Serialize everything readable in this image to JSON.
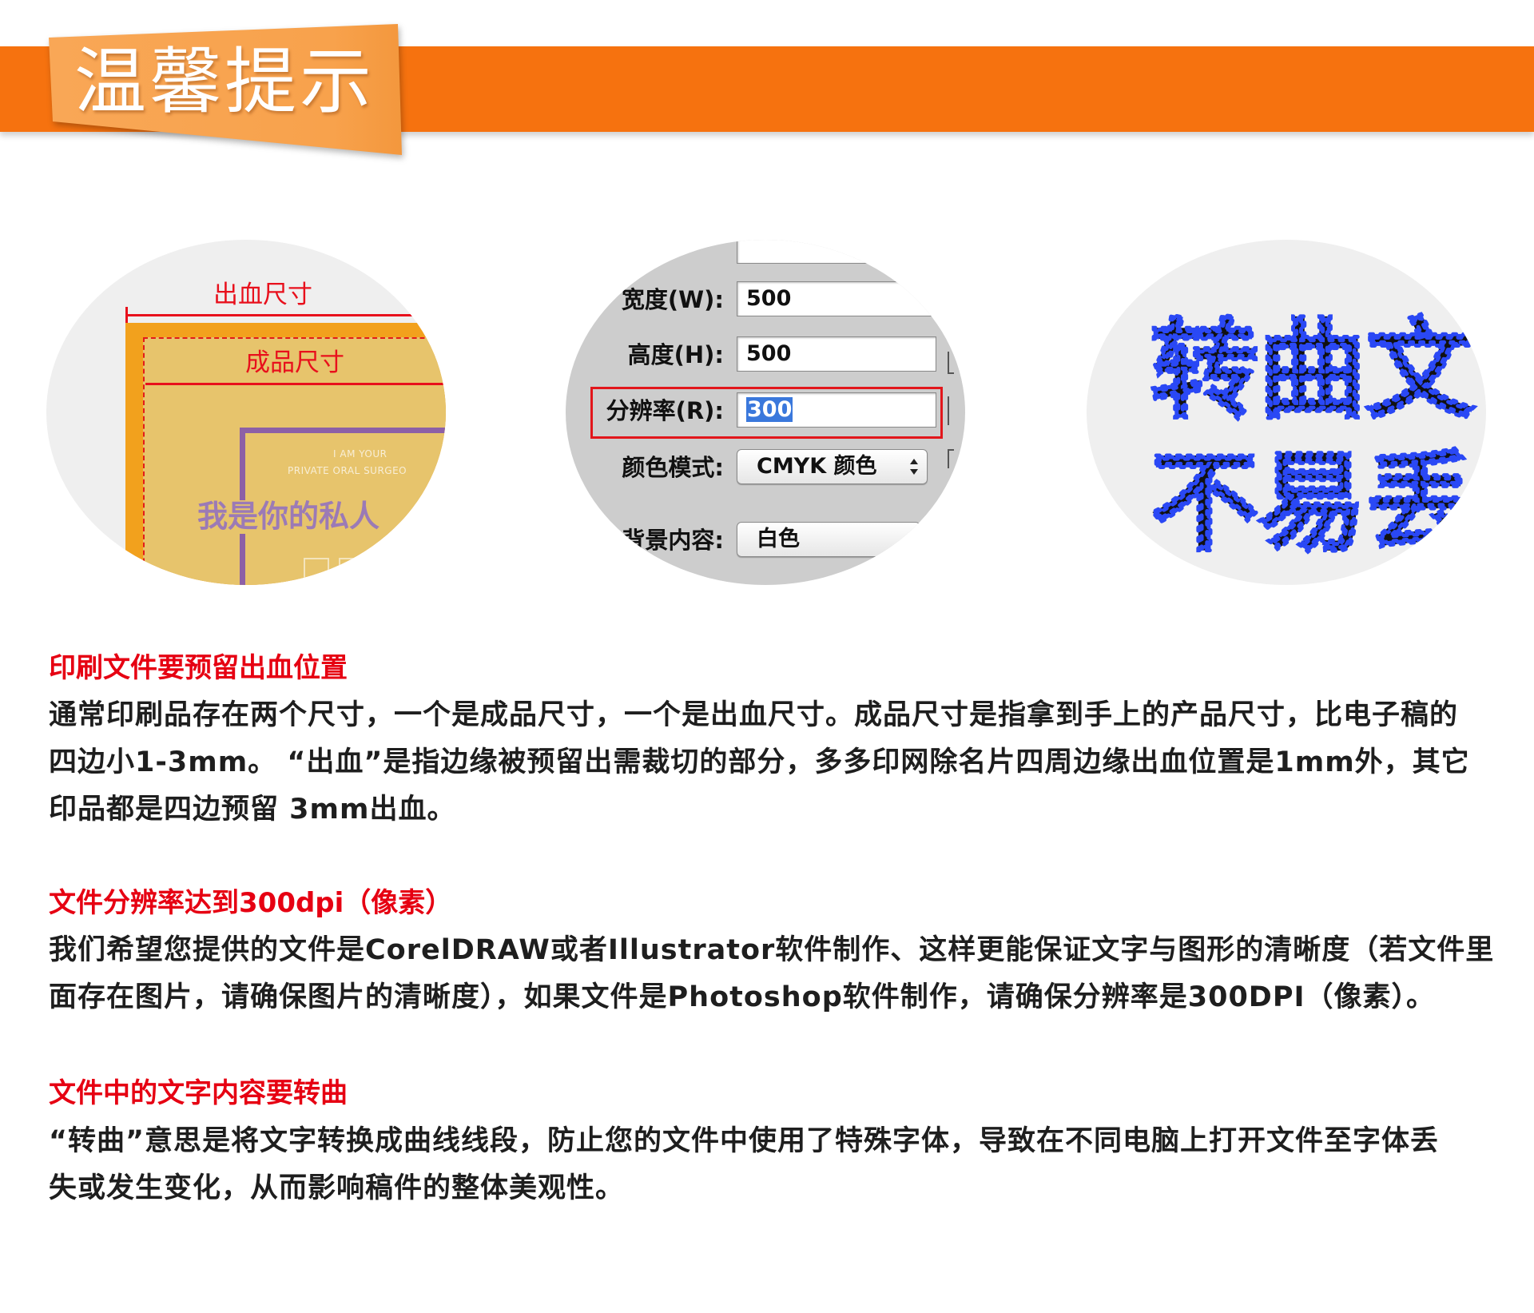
{
  "banner": {
    "title": "温馨提示"
  },
  "theme": {
    "banner": "#f6720f",
    "tab": "#f8a24c",
    "heading": "#e60012",
    "body": "#1e1e1e"
  },
  "illustrations": {
    "bleed": {
      "bleed_label": "出血尺寸",
      "trim_label": "成品尺寸",
      "sample_en_1": "I AM YOUR",
      "sample_en_2": "PRIVATE ORAL SURGEO",
      "sample_cn": "我是你的私人"
    },
    "dialog": {
      "rows": [
        {
          "label": "宽度(W):",
          "value": "500"
        },
        {
          "label": "高度(H):",
          "value": "500"
        },
        {
          "label": "分辨率(R):",
          "value": "300"
        },
        {
          "label": "颜色模式:",
          "value": "CMYK 颜色"
        },
        {
          "label": "背景内容:",
          "value": "白色"
        }
      ],
      "selection_color": "#3a78dc",
      "highlight_color": "#e2161b"
    },
    "outline": {
      "line1": "转曲文",
      "line2": "不易丢",
      "node_color": "#2a48f5"
    }
  },
  "sections": [
    {
      "heading": "印刷文件要预留出血位置",
      "lines": [
        "通常印刷品存在两个尺寸，一个是成品尺寸，一个是出血尺寸。成品尺寸是指拿到手上的产品尺寸，比电子稿的",
        "四边小1-3mm。 “出血”是指边缘被预留出需裁切的部分，多多印网除名片四周边缘出血位置是1mm外，其它",
        "印品都是四边预留 3mm出血。"
      ]
    },
    {
      "heading": "文件分辨率达到300dpi（像素）",
      "lines": [
        "我们希望您提供的文件是CorelDRAW或者Illustrator软件制作、这样更能保证文字与图形的清晰度（若文件里",
        "面存在图片，请确保图片的清晰度），如果文件是Photoshop软件制作，请确保分辨率是300DPI（像素）。"
      ]
    },
    {
      "heading": "文件中的文字内容要转曲",
      "lines": [
        "“转曲”意思是将文字转换成曲线线段，防止您的文件中使用了特殊字体，导致在不同电脑上打开文件至字体丢",
        "失或发生变化，从而影响稿件的整体美观性。"
      ]
    }
  ]
}
